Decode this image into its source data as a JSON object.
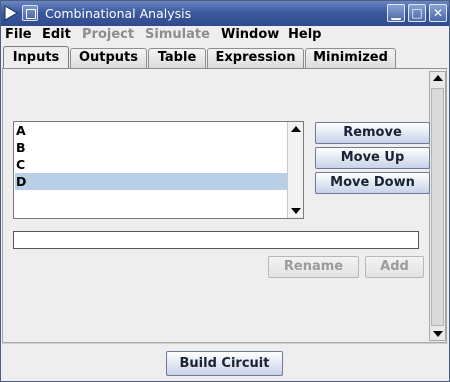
{
  "window": {
    "title": "Combinational Analysis",
    "controls": {
      "minimize": "▁",
      "maximize": "□",
      "close": "✕"
    },
    "accent": "#3c5aa0"
  },
  "menubar": [
    "File",
    "Edit",
    "Project",
    "Simulate",
    "Window",
    "Help"
  ],
  "tabs": [
    "Inputs",
    "Outputs",
    "Table",
    "Expression",
    "Minimized"
  ],
  "active_tab": "Inputs",
  "variables": [
    "A",
    "B",
    "C",
    "D"
  ],
  "selected_variable": "D",
  "buttons": {
    "remove": "Remove",
    "move_up": "Move Up",
    "move_down": "Move Down",
    "rename": "Rename",
    "add": "Add",
    "build": "Build Circuit"
  },
  "name_field": {
    "value": ""
  },
  "colors": {
    "selection": "#b8cfe5",
    "disabled_text": "#8d8d8d"
  }
}
